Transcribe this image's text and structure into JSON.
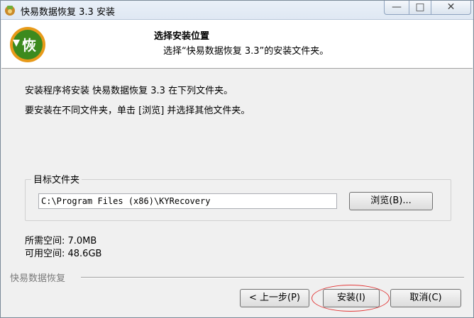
{
  "window": {
    "title": "快易数据恢复 3.3 安装",
    "controls": {
      "minimize": "—",
      "maximize": "□",
      "close": "✕"
    }
  },
  "header": {
    "title": "选择安装位置",
    "subtitle": "选择“快易数据恢复 3.3”的安装文件夹。",
    "logo_text": "恢",
    "logo_icon": "green-circle-arrow-logo"
  },
  "content": {
    "line1": "安装程序将安装 快易数据恢复 3.3 在下列文件夹。",
    "line2": "要安装在不同文件夹，单击 [浏览] 并选择其他文件夹。",
    "target_group_label": "目标文件夹",
    "target_path": "C:\\Program Files (x86)\\KYRecovery",
    "browse_label": "浏览(B)...",
    "space_required": "所需空间: 7.0MB",
    "space_available": "可用空间: 48.6GB"
  },
  "footer": {
    "brand": "快易数据恢复",
    "back_label": "< 上一步(P)",
    "install_label": "安装(I)",
    "cancel_label": "取消(C)"
  },
  "colors": {
    "highlight_circle": "#e23a3a",
    "logo_green": "#3c8a1e",
    "logo_orange": "#e89a1a"
  }
}
